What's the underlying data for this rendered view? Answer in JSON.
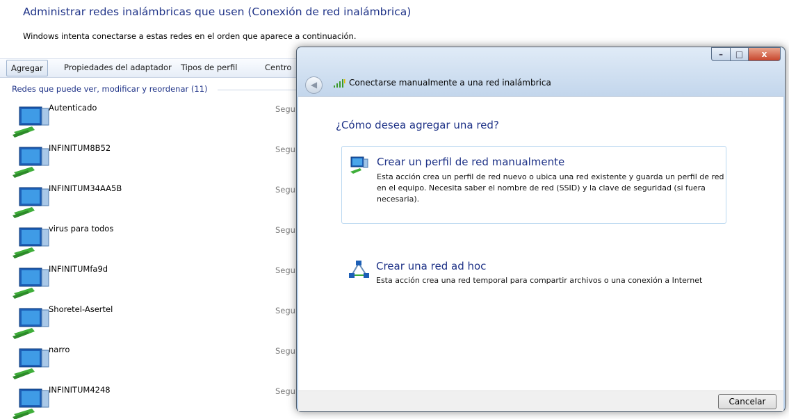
{
  "background": {
    "title": "Administrar redes inalámbricas que usen (Conexión de red inalámbrica)",
    "subtitle": "Windows intenta conectarse a estas redes en el orden que aparece a continuación.",
    "toolbar": [
      "Agregar",
      "Propiedades del adaptador",
      "Tipos de perfil",
      "Centro"
    ],
    "group_header": "Redes que puede ver, modificar y reordenar (11)",
    "security_truncated": "Segu",
    "networks": [
      "Autenticado",
      "INFINITUM8B52",
      "INFINITUM34AA5B",
      "virus para todos",
      "INFINITUMfa9d",
      "Shoretel-Asertel",
      "narro",
      "INFINITUM4248"
    ]
  },
  "dialog": {
    "title": "Conectarse manualmente a una red inalámbrica",
    "question": "¿Cómo desea agregar una red?",
    "options": [
      {
        "title": "Crear un perfil de red manualmente",
        "description": "Esta acción crea un perfil de red nuevo o ubica una red existente y guarda un perfil de red en el equipo. Necesita saber el nombre de red (SSID) y la clave de seguridad (si fuera necesaria)."
      },
      {
        "title": "Crear una red ad hoc",
        "description": "Esta acción crea una red temporal para compartir archivos o una conexión a Internet"
      }
    ],
    "cancel_label": "Cancelar",
    "controls": {
      "minimize": "–",
      "maximize": "□",
      "close": "x"
    }
  },
  "colors": {
    "accent_text": "#1e3287",
    "close_button": "#c8462d"
  }
}
